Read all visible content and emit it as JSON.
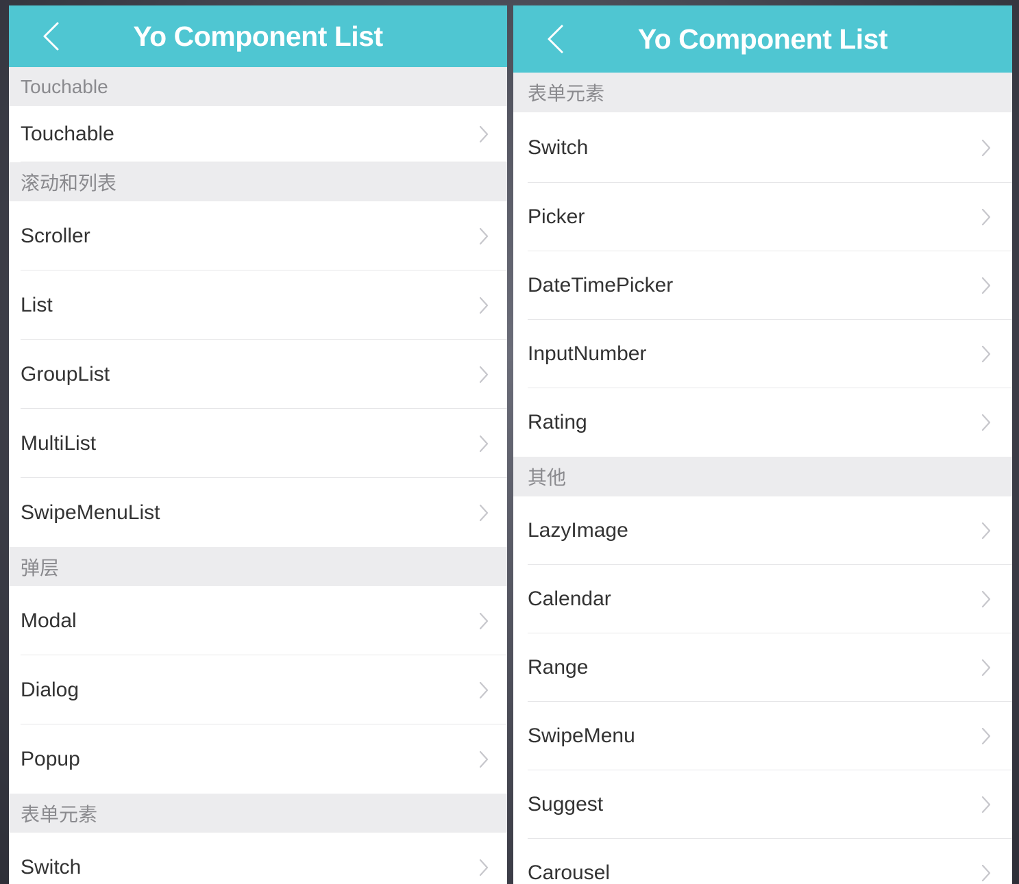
{
  "left": {
    "title": "Yo Component List",
    "items": [
      {
        "type": "section",
        "label": "Touchable"
      },
      {
        "type": "row",
        "label": "Touchable",
        "size": "short"
      },
      {
        "type": "section",
        "label": "滚动和列表"
      },
      {
        "type": "row",
        "label": "Scroller"
      },
      {
        "type": "row",
        "label": "List"
      },
      {
        "type": "row",
        "label": "GroupList"
      },
      {
        "type": "row",
        "label": "MultiList"
      },
      {
        "type": "row",
        "label": "SwipeMenuList",
        "last": true
      },
      {
        "type": "section",
        "label": "弹层"
      },
      {
        "type": "row",
        "label": "Modal"
      },
      {
        "type": "row",
        "label": "Dialog"
      },
      {
        "type": "row",
        "label": "Popup",
        "last": true
      },
      {
        "type": "section",
        "label": "表单元素"
      },
      {
        "type": "row",
        "label": "Switch"
      }
    ]
  },
  "right": {
    "title": "Yo Component List",
    "items": [
      {
        "type": "section",
        "label": "表单元素"
      },
      {
        "type": "row",
        "label": "Switch",
        "size": "tall"
      },
      {
        "type": "row",
        "label": "Picker"
      },
      {
        "type": "row",
        "label": "DateTimePicker"
      },
      {
        "type": "row",
        "label": "InputNumber"
      },
      {
        "type": "row",
        "label": "Rating",
        "last": true
      },
      {
        "type": "section",
        "label": "其他"
      },
      {
        "type": "row",
        "label": "LazyImage"
      },
      {
        "type": "row",
        "label": "Calendar"
      },
      {
        "type": "row",
        "label": "Range"
      },
      {
        "type": "row",
        "label": "SwipeMenu"
      },
      {
        "type": "row",
        "label": "Suggest"
      },
      {
        "type": "row",
        "label": "Carousel"
      }
    ]
  },
  "colors": {
    "navbar": "#4fc6d2",
    "section_bg": "#ececee",
    "row_text": "#333333",
    "section_text": "#8a8a8e",
    "backdrop": "#3c3d47"
  },
  "icons": {
    "back": "chevron-left-icon",
    "row_disclosure": "chevron-right-icon"
  }
}
